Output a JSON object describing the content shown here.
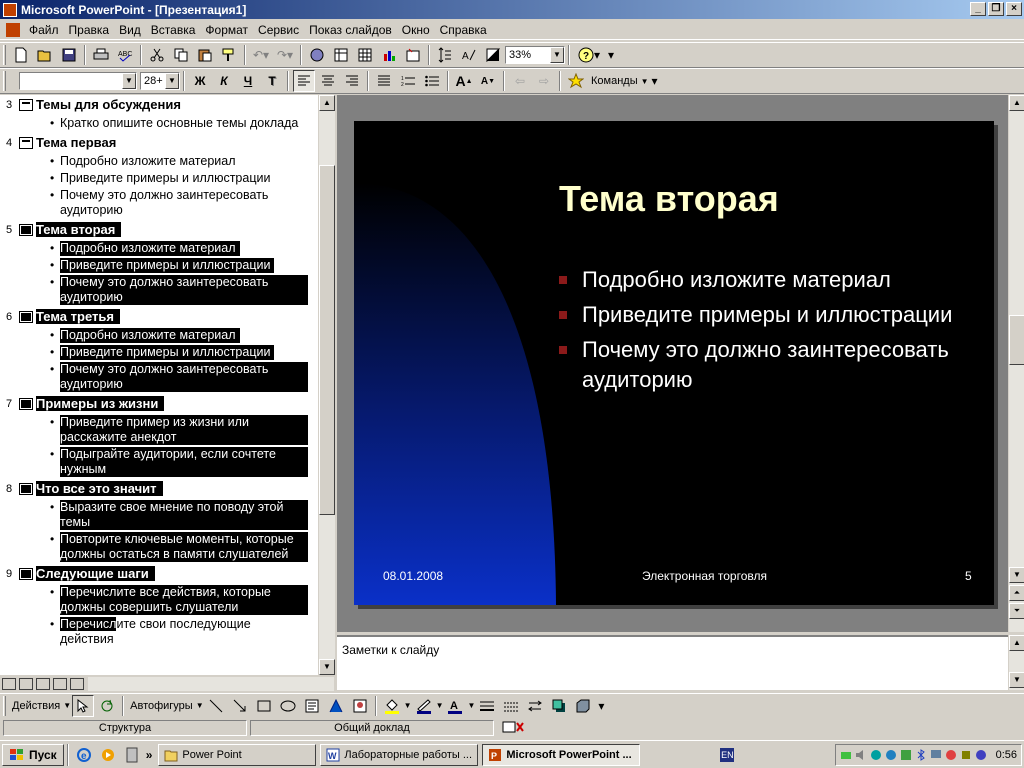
{
  "window": {
    "title": "Microsoft PowerPoint - [Презентация1]",
    "min_label": "_",
    "restore_label": "❐",
    "close_label": "×"
  },
  "menu": {
    "items": [
      "Файл",
      "Правка",
      "Вид",
      "Вставка",
      "Формат",
      "Сервис",
      "Показ слайдов",
      "Окно",
      "Справка"
    ]
  },
  "toolbar": {
    "zoom_value": "33%",
    "font_name": "",
    "font_size": "28+",
    "bold_label": "Ж",
    "italic_label": "К",
    "underline_label": "Ч",
    "shadow_label": "Т",
    "commands_label": "Команды"
  },
  "outline": {
    "slides": [
      {
        "num": "3",
        "title": "Темы для обсуждения",
        "selected": false,
        "bullets": [
          "Кратко опишите основные темы доклада"
        ]
      },
      {
        "num": "4",
        "title": "Тема первая",
        "selected": false,
        "bullets": [
          "Подробно изложите материал",
          "Приведите примеры и иллюстрации",
          "Почему это должно заинтересовать аудиторию"
        ]
      },
      {
        "num": "5",
        "title": "Тема вторая",
        "selected": true,
        "bullets": [
          "Подробно изложите материал",
          "Приведите примеры и иллюстрации",
          "Почему это должно заинтересовать аудиторию"
        ]
      },
      {
        "num": "6",
        "title": "Тема третья",
        "selected": true,
        "bullets": [
          "Подробно изложите материал",
          "Приведите примеры и иллюстрации",
          "Почему это должно заинтересовать аудиторию"
        ]
      },
      {
        "num": "7",
        "title": "Примеры из жизни",
        "selected": true,
        "bullets": [
          "Приведите пример из жизни или расскажите анекдот",
          "Подыграйте аудитории, если сочтете нужным"
        ]
      },
      {
        "num": "8",
        "title": "Что все это значит",
        "selected": true,
        "bullets": [
          "Выразите свое мнение по поводу этой темы",
          "Повторите ключевые моменты, которые должны остаться в памяти слушателей"
        ]
      },
      {
        "num": "9",
        "title": "Следующие шаги",
        "selected": true,
        "bullets": [
          "Перечислите все действия, которые должны совершить слушатели",
          "Перечислите свои последующие действия"
        ]
      }
    ]
  },
  "slide": {
    "title": "Тема вторая",
    "bullets": [
      "Подробно изложите материал",
      "Приведите примеры и иллюстрации",
      "Почему это должно заинтересовать аудиторию"
    ],
    "footer_date": "08.01.2008",
    "footer_center": "Электронная торговля",
    "footer_page": "5",
    "colors": {
      "background": "#000000",
      "title": "#ffffcc",
      "bullet_marker": "#8b1a1a",
      "gradient": "#0a2bb8"
    }
  },
  "notes": {
    "placeholder": "Заметки к слайду"
  },
  "drawing": {
    "actions_label": "Действия",
    "autoshapes_label": "Автофигуры"
  },
  "status": {
    "mode": "Структура",
    "design": "Общий доклад"
  },
  "taskbar": {
    "start_label": "Пуск",
    "tasks": [
      "Power Point",
      "Лабораторные работы ...",
      "Microsoft PowerPoint ..."
    ],
    "lang": "EN",
    "clock": "0:56"
  }
}
